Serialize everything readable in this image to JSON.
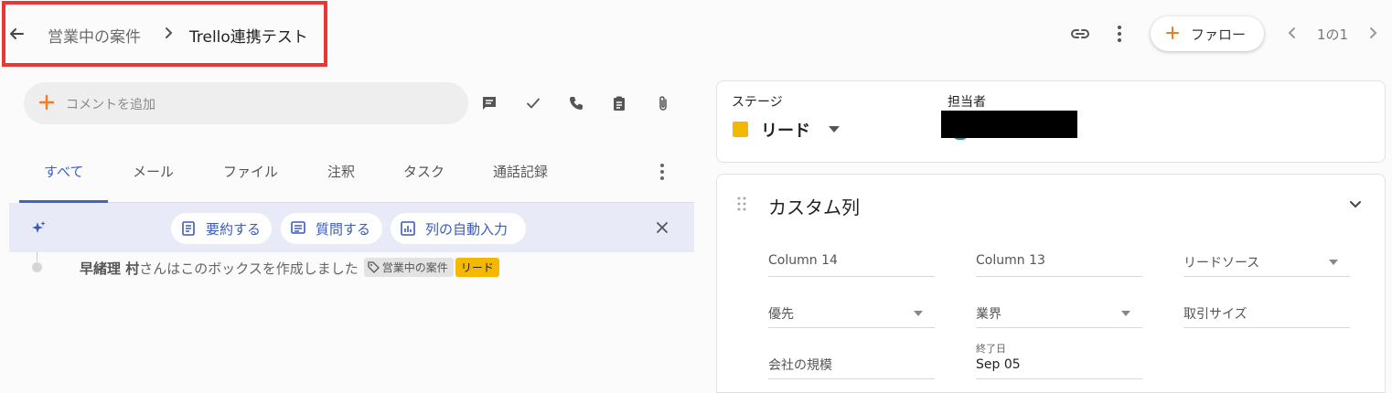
{
  "header": {
    "breadcrumb_parent": "営業中の案件",
    "breadcrumb_current": "Trello連携テスト",
    "follow_label": "ファロー",
    "pagination": "1の1"
  },
  "comment": {
    "placeholder": "コメントを追加"
  },
  "tabs": [
    {
      "label": "すべて",
      "active": true
    },
    {
      "label": "メール"
    },
    {
      "label": "ファイル"
    },
    {
      "label": "注釈"
    },
    {
      "label": "タスク"
    },
    {
      "label": "通話記録"
    }
  ],
  "ai_actions": [
    {
      "label": "要約する",
      "icon": "summary-icon"
    },
    {
      "label": "質問する",
      "icon": "question-icon"
    },
    {
      "label": "列の自動入力",
      "icon": "autofill-icon"
    }
  ],
  "activity": {
    "user": "早緒理 村",
    "text": "さんはこのボックスを作成しました",
    "stage_tag": "営業中の案件",
    "lead_tag": "リード"
  },
  "stage_panel": {
    "stage_label": "ステージ",
    "stage_value": "リード",
    "stage_color": "#f5b800",
    "owner_label": "担当者"
  },
  "custom_panel": {
    "title": "カスタム列",
    "fields": [
      {
        "label": "Column 14"
      },
      {
        "label": "Column 13"
      },
      {
        "label": "リードソース",
        "dropdown": true
      },
      {
        "label": "優先",
        "dropdown": true
      },
      {
        "label": "業界",
        "dropdown": true
      },
      {
        "label": "取引サイズ"
      },
      {
        "label": "会社の規模"
      },
      {
        "label": "終了日",
        "value": "Sep 05"
      }
    ]
  },
  "colors": {
    "accent": "#3f63c8",
    "orange": "#f47b20",
    "highlight": "#e53935"
  }
}
